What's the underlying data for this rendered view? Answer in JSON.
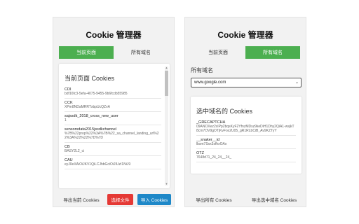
{
  "left": {
    "title": "Cookie 管理器",
    "tabs": [
      {
        "label": "当前页面",
        "active": true
      },
      {
        "label": "所有域名",
        "active": false
      }
    ],
    "card_heading": "当前页面 Cookies",
    "cookies": [
      {
        "name": "CDI",
        "value": "bdf16fc3-5efa-4075-9455-9b6fcdb55985"
      },
      {
        "name": "CCK",
        "value": "XPm8NDaMRRTxbpUcQZvA"
      },
      {
        "name": "sajssdk_2018_cross_new_user",
        "value": "1"
      },
      {
        "name": "sensorsdata2015jssdkchannel",
        "value": "%7B%22prop%22%3A%7B%22_sa_channel_landing_url%22%3A%22%22%7D%7D"
      },
      {
        "name": "CB",
        "value": "BASY2L2_ci"
      },
      {
        "name": "CAU",
        "value": "eyJ0eXAiOiJKV1QiLCJhbGciOiJIUzI1NiJ9"
      }
    ],
    "buttons": {
      "export_current": "导出当前 Cookies",
      "choose_file": "选择文件",
      "import": "导入 Cookies"
    },
    "colors": {
      "tab_active": "#4caf50",
      "choose_file": "#e53935",
      "import": "#1e88c8"
    }
  },
  "right": {
    "title": "Cookie 管理器",
    "tabs": [
      {
        "label": "当前页面",
        "active": false
      },
      {
        "label": "所有域名",
        "active": true
      }
    ],
    "all_domains_label": "所有域名",
    "selected_domain": "www.google.com",
    "card_heading": "选中域名的 Cookies",
    "cookies": [
      {
        "name": "_GRECAPTCHA",
        "value": "09ANOXez2xIPp2bqsKyF2YfnzMDsz9keDiH1Dhy2QiA1-wsjkT8cm7OV9gOTjKvFox2U05_gR1RLbCiB_Av9KZTyY"
      },
      {
        "name": "__snaker__id",
        "value": "lbsm7Sxx3sfhxOAx"
      },
      {
        "name": "OTZ",
        "value": "7648d71_24_24__24_"
      }
    ],
    "buttons": {
      "export_all": "导出所有 Cookies",
      "export_selected": "导出选中域名 Cookies"
    }
  }
}
